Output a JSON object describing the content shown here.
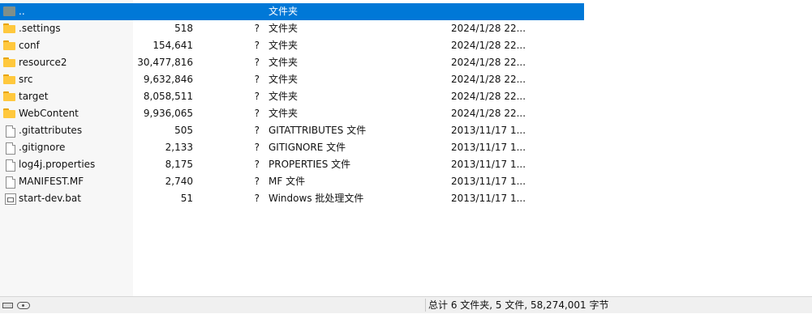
{
  "file_list": {
    "rows": [
      {
        "icon": "up-folder-icon",
        "name": "..",
        "size": "",
        "q": "",
        "type": "文件夹",
        "date": "",
        "selected": true
      },
      {
        "icon": "folder-icon",
        "name": ".settings",
        "size": "518",
        "q": "?",
        "type": "文件夹",
        "date": "2024/1/28 22..."
      },
      {
        "icon": "folder-icon",
        "name": "conf",
        "size": "154,641",
        "q": "?",
        "type": "文件夹",
        "date": "2024/1/28 22..."
      },
      {
        "icon": "folder-icon",
        "name": "resource2",
        "size": "30,477,816",
        "q": "?",
        "type": "文件夹",
        "date": "2024/1/28 22..."
      },
      {
        "icon": "folder-icon",
        "name": "src",
        "size": "9,632,846",
        "q": "?",
        "type": "文件夹",
        "date": "2024/1/28 22..."
      },
      {
        "icon": "folder-icon",
        "name": "target",
        "size": "8,058,511",
        "q": "?",
        "type": "文件夹",
        "date": "2024/1/28 22..."
      },
      {
        "icon": "folder-icon",
        "name": "WebContent",
        "size": "9,936,065",
        "q": "?",
        "type": "文件夹",
        "date": "2024/1/28 22..."
      },
      {
        "icon": "file-icon",
        "name": ".gitattributes",
        "size": "505",
        "q": "?",
        "type": "GITATTRIBUTES 文件",
        "date": "2013/11/17 1..."
      },
      {
        "icon": "file-icon",
        "name": ".gitignore",
        "size": "2,133",
        "q": "?",
        "type": "GITIGNORE 文件",
        "date": "2013/11/17 1..."
      },
      {
        "icon": "file-icon",
        "name": "log4j.properties",
        "size": "8,175",
        "q": "?",
        "type": "PROPERTIES 文件",
        "date": "2013/11/17 1..."
      },
      {
        "icon": "file-icon",
        "name": "MANIFEST.MF",
        "size": "2,740",
        "q": "?",
        "type": "MF 文件",
        "date": "2013/11/17 1..."
      },
      {
        "icon": "bat-file-icon",
        "name": "start-dev.bat",
        "size": "51",
        "q": "?",
        "type": "Windows 批处理文件",
        "date": "2013/11/17 1..."
      }
    ]
  },
  "status_bar": {
    "summary": "总计 6 文件夹, 5 文件, 58,274,001 字节",
    "icons": [
      "drive-icon",
      "network-icon"
    ]
  },
  "colors": {
    "selection": "#0078d7",
    "left_strip": "#f7f7f7",
    "status_bar": "#f0f0f0"
  }
}
